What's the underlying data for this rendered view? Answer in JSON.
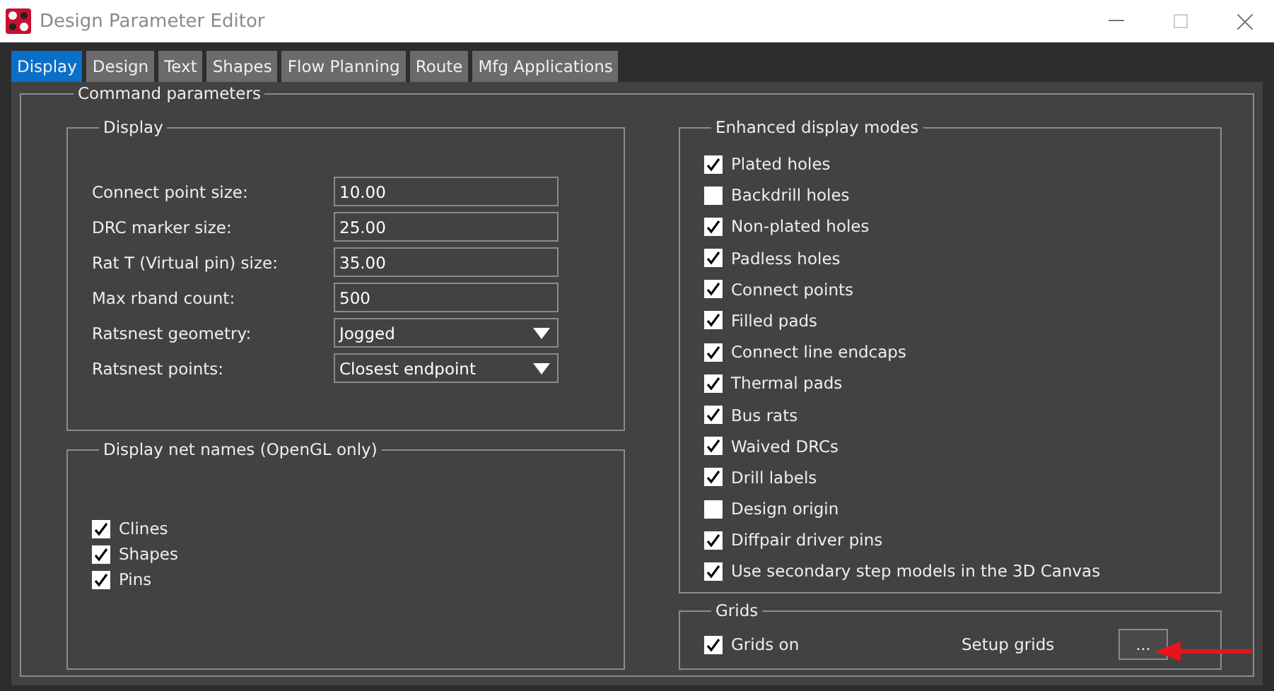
{
  "window": {
    "title": "Design Parameter Editor"
  },
  "tabs": [
    {
      "label": "Display",
      "selected": true
    },
    {
      "label": "Design",
      "selected": false
    },
    {
      "label": "Text",
      "selected": false
    },
    {
      "label": "Shapes",
      "selected": false
    },
    {
      "label": "Flow Planning",
      "selected": false
    },
    {
      "label": "Route",
      "selected": false
    },
    {
      "label": "Mfg Applications",
      "selected": false
    }
  ],
  "command_parameters": {
    "title": "Command parameters",
    "display": {
      "title": "Display",
      "fields": [
        {
          "label": "Connect point size:",
          "value": "10.00",
          "kind": "text"
        },
        {
          "label": "DRC marker size:",
          "value": "25.00",
          "kind": "text"
        },
        {
          "label": "Rat T (Virtual pin) size:",
          "value": "35.00",
          "kind": "text"
        },
        {
          "label": "Max rband count:",
          "value": "500",
          "kind": "text"
        },
        {
          "label": "Ratsnest geometry:",
          "value": "Jogged",
          "kind": "dropdown"
        },
        {
          "label": "Ratsnest points:",
          "value": "Closest endpoint",
          "kind": "dropdown"
        }
      ]
    },
    "net_names": {
      "title": "Display net names (OpenGL only)",
      "options": [
        {
          "label": "Clines",
          "checked": true
        },
        {
          "label": "Shapes",
          "checked": true
        },
        {
          "label": "Pins",
          "checked": true
        }
      ]
    },
    "enhanced_display_modes": {
      "title": "Enhanced display modes",
      "options": [
        {
          "label": "Plated holes",
          "checked": true
        },
        {
          "label": "Backdrill holes",
          "checked": false
        },
        {
          "label": "Non-plated holes",
          "checked": true
        },
        {
          "label": "Padless holes",
          "checked": true
        },
        {
          "label": "Connect points",
          "checked": true
        },
        {
          "label": "Filled pads",
          "checked": true
        },
        {
          "label": "Connect line endcaps",
          "checked": true
        },
        {
          "label": "Thermal pads",
          "checked": true
        },
        {
          "label": "Bus rats",
          "checked": true
        },
        {
          "label": "Waived DRCs",
          "checked": true
        },
        {
          "label": "Drill labels",
          "checked": true
        },
        {
          "label": "Design origin",
          "checked": false
        },
        {
          "label": "Diffpair driver pins",
          "checked": true
        },
        {
          "label": "Use secondary step models in the 3D Canvas",
          "checked": true
        }
      ]
    },
    "grids": {
      "title": "Grids",
      "options": [
        {
          "label": "Grids on",
          "checked": true
        }
      ],
      "setup_label": "Setup grids",
      "setup_button": "..."
    }
  }
}
